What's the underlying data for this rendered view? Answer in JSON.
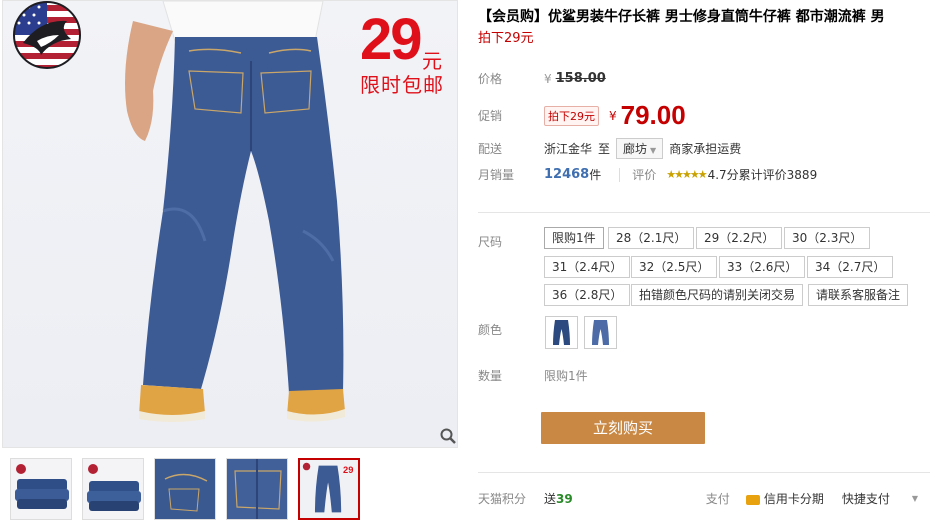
{
  "promo": {
    "price": "29",
    "unit": "元",
    "text": "限时包邮"
  },
  "product": {
    "title": "【会员购】优鲨男装牛仔长裤 男士修身直筒牛仔裤 都市潮流裤 男",
    "subtitle": "拍下29元"
  },
  "price_row": {
    "label": "价格",
    "currency": "¥",
    "original": "158.00"
  },
  "promo_row": {
    "label": "促销",
    "tag": "拍下29元",
    "currency": "¥",
    "price": "79.00"
  },
  "delivery": {
    "label": "配送",
    "from": "浙江金华",
    "to_word": "至",
    "city": "廊坊",
    "note": "商家承担运费"
  },
  "sales": {
    "label": "月销量",
    "count": "12468",
    "unit": "件",
    "review_label": "评价",
    "stars": "★★★★★",
    "score_text": "4.7分累计评价3889",
    "score": 4.7
  },
  "sizes": {
    "label": "尺码",
    "options": [
      "限购1件",
      "28（2.1尺）",
      "29（2.2尺）",
      "30（2.3尺）",
      "31（2.4尺）",
      "32（2.5尺）",
      "33（2.6尺）",
      "34（2.7尺）",
      "36（2.8尺）",
      "拍错颜色尺码的请别关闭交易",
      "请联系客服备注"
    ]
  },
  "color": {
    "label": "颜色"
  },
  "quantity": {
    "label": "数量",
    "note": "限购1件"
  },
  "buy_button": "立刻购买",
  "footer": {
    "points_label": "天猫积分",
    "points_prefix": "送",
    "points": "39",
    "pay_label": "支付",
    "installment": "信用卡分期",
    "quick_pay": "快捷支付"
  },
  "icons": [
    "brand-shark-logo-icon",
    "zoom-magnifier-icon",
    "dropdown-caret-icon",
    "credit-card-icon"
  ],
  "colors": {
    "accent_red": "#c40000",
    "buy_button": "#c98945",
    "link_blue": "#3f6fb0"
  }
}
